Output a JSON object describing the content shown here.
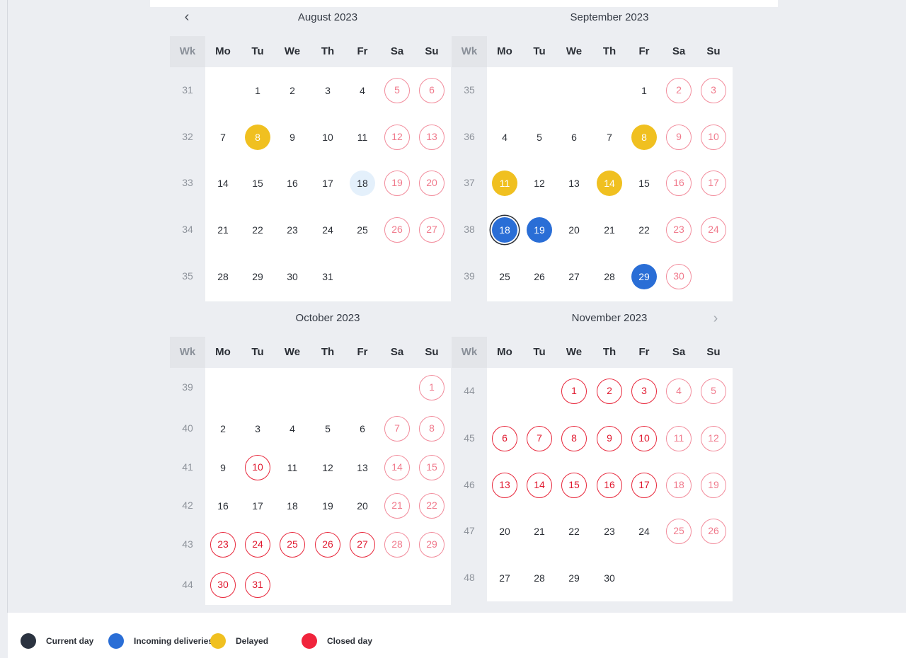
{
  "nav": {
    "prev_icon": "‹",
    "next_icon": "›"
  },
  "header_labels": [
    "Wk",
    "Mo",
    "Tu",
    "We",
    "Th",
    "Fr",
    "Sa",
    "Su"
  ],
  "colors": {
    "current": "#2b3340",
    "incoming": "#2a6ed6",
    "delayed": "#f0c020",
    "closed": "#f0243c",
    "weekend_outline": "#f28c9c"
  },
  "months": [
    {
      "title": "August  2023",
      "weeks": [
        {
          "wk": "31",
          "days": [
            "",
            "1",
            "2",
            "3",
            "4",
            "5",
            "6"
          ]
        },
        {
          "wk": "32",
          "days": [
            "7",
            "8",
            "9",
            "10",
            "11",
            "12",
            "13"
          ]
        },
        {
          "wk": "33",
          "days": [
            "14",
            "15",
            "16",
            "17",
            "18",
            "19",
            "20"
          ]
        },
        {
          "wk": "34",
          "days": [
            "21",
            "22",
            "23",
            "24",
            "25",
            "26",
            "27"
          ]
        },
        {
          "wk": "35",
          "days": [
            "28",
            "29",
            "30",
            "31",
            "",
            "",
            ""
          ]
        }
      ],
      "status": {
        "8": "delayed",
        "18": "today-hint"
      }
    },
    {
      "title": "September  2023",
      "weeks": [
        {
          "wk": "35",
          "days": [
            "",
            "",
            "",
            "",
            "1",
            "2",
            "3"
          ]
        },
        {
          "wk": "36",
          "days": [
            "4",
            "5",
            "6",
            "7",
            "8",
            "9",
            "10"
          ]
        },
        {
          "wk": "37",
          "days": [
            "11",
            "12",
            "13",
            "14",
            "15",
            "16",
            "17"
          ]
        },
        {
          "wk": "38",
          "days": [
            "18",
            "19",
            "20",
            "21",
            "22",
            "23",
            "24"
          ]
        },
        {
          "wk": "39",
          "days": [
            "25",
            "26",
            "27",
            "28",
            "29",
            "30",
            ""
          ]
        }
      ],
      "status": {
        "8": "delayed",
        "11": "delayed",
        "14": "delayed",
        "18": "current",
        "19": "incoming",
        "29": "incoming"
      }
    },
    {
      "title": "October  2023",
      "weeks": [
        {
          "wk": "39",
          "days": [
            "",
            "",
            "",
            "",
            "",
            "",
            "1"
          ]
        },
        {
          "wk": "40",
          "days": [
            "2",
            "3",
            "4",
            "5",
            "6",
            "7",
            "8"
          ]
        },
        {
          "wk": "41",
          "days": [
            "9",
            "10",
            "11",
            "12",
            "13",
            "14",
            "15"
          ]
        },
        {
          "wk": "42",
          "days": [
            "16",
            "17",
            "18",
            "19",
            "20",
            "21",
            "22"
          ]
        },
        {
          "wk": "43",
          "days": [
            "23",
            "24",
            "25",
            "26",
            "27",
            "28",
            "29"
          ]
        },
        {
          "wk": "44",
          "days": [
            "30",
            "31",
            "",
            "",
            "",
            "",
            ""
          ]
        }
      ],
      "status": {
        "10": "closed",
        "23": "closed",
        "24": "closed",
        "25": "closed",
        "26": "closed",
        "27": "closed",
        "30": "closed",
        "31": "closed"
      }
    },
    {
      "title": "November  2023",
      "weeks": [
        {
          "wk": "44",
          "days": [
            "",
            "",
            "1",
            "2",
            "3",
            "4",
            "5"
          ]
        },
        {
          "wk": "45",
          "days": [
            "6",
            "7",
            "8",
            "9",
            "10",
            "11",
            "12"
          ]
        },
        {
          "wk": "46",
          "days": [
            "13",
            "14",
            "15",
            "16",
            "17",
            "18",
            "19"
          ]
        },
        {
          "wk": "47",
          "days": [
            "20",
            "21",
            "22",
            "23",
            "24",
            "25",
            "26"
          ]
        },
        {
          "wk": "48",
          "days": [
            "27",
            "28",
            "29",
            "30",
            "",
            "",
            ""
          ]
        }
      ],
      "status": {
        "1": "closed",
        "2": "closed",
        "3": "closed",
        "6": "closed",
        "7": "closed",
        "8": "closed",
        "9": "closed",
        "10": "closed",
        "13": "closed",
        "14": "closed",
        "15": "closed",
        "16": "closed",
        "17": "closed"
      }
    }
  ],
  "legend": [
    {
      "label": "Current day",
      "color": "#2b3340",
      "icon": "current-day-dot-icon"
    },
    {
      "label": "Incoming deliveries",
      "color": "#2a6ed6",
      "icon": "incoming-dot-icon"
    },
    {
      "label": "Delayed",
      "color": "#f0c020",
      "icon": "delayed-dot-icon"
    },
    {
      "label": "Closed day",
      "color": "#f0243c",
      "icon": "closed-dot-icon"
    }
  ]
}
